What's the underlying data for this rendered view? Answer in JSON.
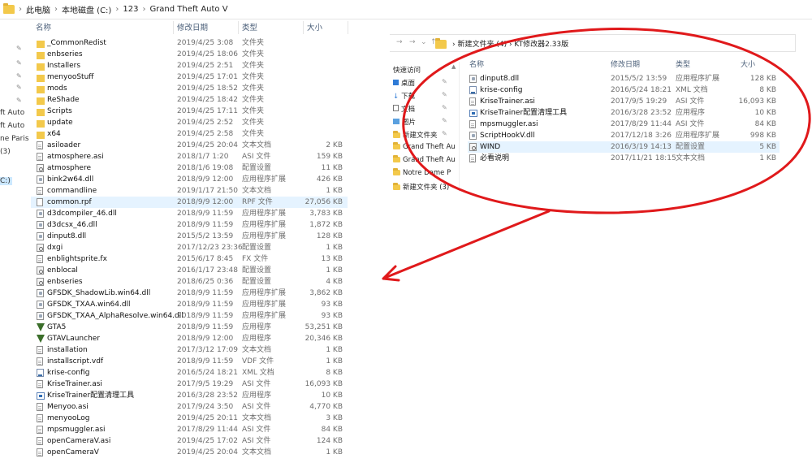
{
  "breadcrumb": [
    "此电脑",
    "本地磁盘 (C:)",
    "123",
    "Grand Theft Auto V"
  ],
  "tree": {
    "items": [
      "ft Auto",
      "ft Auto",
      "ne Paris",
      "(3)",
      "C:)"
    ]
  },
  "columns": {
    "name": "名称",
    "date": "修改日期",
    "type": "类型",
    "size": "大小"
  },
  "files": [
    {
      "name": "_CommonRedist",
      "date": "2019/4/25 3:08",
      "type": "文件夹",
      "size": "",
      "icon": "folder"
    },
    {
      "name": "enbseries",
      "date": "2019/4/25 18:06",
      "type": "文件夹",
      "size": "",
      "icon": "folder"
    },
    {
      "name": "Installers",
      "date": "2019/4/25 2:51",
      "type": "文件夹",
      "size": "",
      "icon": "folder"
    },
    {
      "name": "menyooStuff",
      "date": "2019/4/25 17:01",
      "type": "文件夹",
      "size": "",
      "icon": "folder"
    },
    {
      "name": "mods",
      "date": "2019/4/25 18:52",
      "type": "文件夹",
      "size": "",
      "icon": "folder"
    },
    {
      "name": "ReShade",
      "date": "2019/4/25 18:42",
      "type": "文件夹",
      "size": "",
      "icon": "folder"
    },
    {
      "name": "Scripts",
      "date": "2019/4/25 17:11",
      "type": "文件夹",
      "size": "",
      "icon": "folder"
    },
    {
      "name": "update",
      "date": "2019/4/25 2:52",
      "type": "文件夹",
      "size": "",
      "icon": "folder"
    },
    {
      "name": "x64",
      "date": "2019/4/25 2:58",
      "type": "文件夹",
      "size": "",
      "icon": "folder"
    },
    {
      "name": "asiloader",
      "date": "2019/4/25 20:04",
      "type": "文本文档",
      "size": "2 KB",
      "icon": "file"
    },
    {
      "name": "atmosphere.asi",
      "date": "2018/1/7 1:20",
      "type": "ASI 文件",
      "size": "159 KB",
      "icon": "file"
    },
    {
      "name": "atmosphere",
      "date": "2018/1/6 19:08",
      "type": "配置设置",
      "size": "11 KB",
      "icon": "cfg"
    },
    {
      "name": "bink2w64.dll",
      "date": "2018/9/9 12:00",
      "type": "应用程序扩展",
      "size": "426 KB",
      "icon": "dll"
    },
    {
      "name": "commandline",
      "date": "2019/1/17 21:50",
      "type": "文本文档",
      "size": "1 KB",
      "icon": "file"
    },
    {
      "name": "common.rpf",
      "date": "2018/9/9 12:00",
      "type": "RPF 文件",
      "size": "27,056 KB",
      "icon": "rpf"
    },
    {
      "name": "d3dcompiler_46.dll",
      "date": "2018/9/9 11:59",
      "type": "应用程序扩展",
      "size": "3,783 KB",
      "icon": "dll"
    },
    {
      "name": "d3dcsx_46.dll",
      "date": "2018/9/9 11:59",
      "type": "应用程序扩展",
      "size": "1,872 KB",
      "icon": "dll"
    },
    {
      "name": "dinput8.dll",
      "date": "2015/5/2 13:59",
      "type": "应用程序扩展",
      "size": "128 KB",
      "icon": "dll"
    },
    {
      "name": "dxgi",
      "date": "2017/12/23 23:36",
      "type": "配置设置",
      "size": "1 KB",
      "icon": "cfg"
    },
    {
      "name": "enblightsprite.fx",
      "date": "2015/6/17 8:45",
      "type": "FX 文件",
      "size": "13 KB",
      "icon": "file"
    },
    {
      "name": "enblocal",
      "date": "2016/1/17 23:48",
      "type": "配置设置",
      "size": "1 KB",
      "icon": "cfg"
    },
    {
      "name": "enbseries",
      "date": "2018/6/25 0:36",
      "type": "配置设置",
      "size": "4 KB",
      "icon": "cfg"
    },
    {
      "name": "GFSDK_ShadowLib.win64.dll",
      "date": "2018/9/9 11:59",
      "type": "应用程序扩展",
      "size": "3,862 KB",
      "icon": "dll"
    },
    {
      "name": "GFSDK_TXAA.win64.dll",
      "date": "2018/9/9 11:59",
      "type": "应用程序扩展",
      "size": "93 KB",
      "icon": "dll"
    },
    {
      "name": "GFSDK_TXAA_AlphaResolve.win64.dll",
      "date": "2018/9/9 11:59",
      "type": "应用程序扩展",
      "size": "93 KB",
      "icon": "dll"
    },
    {
      "name": "GTA5",
      "date": "2018/9/9 11:59",
      "type": "应用程序",
      "size": "53,251 KB",
      "icon": "gta"
    },
    {
      "name": "GTAVLauncher",
      "date": "2018/9/9 12:00",
      "type": "应用程序",
      "size": "20,346 KB",
      "icon": "gta"
    },
    {
      "name": "installation",
      "date": "2017/3/12 17:09",
      "type": "文本文档",
      "size": "1 KB",
      "icon": "file"
    },
    {
      "name": "installscript.vdf",
      "date": "2018/9/9 11:59",
      "type": "VDF 文件",
      "size": "1 KB",
      "icon": "file"
    },
    {
      "name": "krise-config",
      "date": "2016/5/24 18:21",
      "type": "XML 文档",
      "size": "8 KB",
      "icon": "xml"
    },
    {
      "name": "KriseTrainer.asi",
      "date": "2017/9/5 19:29",
      "type": "ASI 文件",
      "size": "16,093 KB",
      "icon": "file"
    },
    {
      "name": "KriseTrainer配置清理工具",
      "date": "2016/3/28 23:52",
      "type": "应用程序",
      "size": "10 KB",
      "icon": "app"
    },
    {
      "name": "Menyoo.asi",
      "date": "2017/9/24 3:50",
      "type": "ASI 文件",
      "size": "4,770 KB",
      "icon": "file"
    },
    {
      "name": "menyooLog",
      "date": "2019/4/25 20:11",
      "type": "文本文档",
      "size": "3 KB",
      "icon": "file"
    },
    {
      "name": "mpsmuggler.asi",
      "date": "2017/8/29 11:44",
      "type": "ASI 文件",
      "size": "84 KB",
      "icon": "file"
    },
    {
      "name": "openCameraV.asi",
      "date": "2019/4/25 17:02",
      "type": "ASI 文件",
      "size": "124 KB",
      "icon": "file"
    },
    {
      "name": "openCameraV",
      "date": "2019/4/25 20:04",
      "type": "文本文档",
      "size": "1 KB",
      "icon": "file"
    }
  ],
  "window2": {
    "path": [
      "新建文件夹 (4)",
      "KT修改器2.33版"
    ],
    "sidebar": [
      "快速访问",
      "桌面",
      "下载",
      "文档",
      "图片",
      "新建文件夹",
      "Grand Theft Au",
      "Grand Theft Au",
      "Notre Dame P",
      "新建文件夹 (3)"
    ],
    "columns": {
      "name": "名称",
      "date": "修改日期",
      "type": "类型",
      "size": "大小"
    },
    "files": [
      {
        "name": "dinput8.dll",
        "date": "2015/5/2 13:59",
        "type": "应用程序扩展",
        "size": "128 KB",
        "icon": "dll"
      },
      {
        "name": "krise-config",
        "date": "2016/5/24 18:21",
        "type": "XML 文档",
        "size": "8 KB",
        "icon": "xml"
      },
      {
        "name": "KriseTrainer.asi",
        "date": "2017/9/5 19:29",
        "type": "ASI 文件",
        "size": "16,093 KB",
        "icon": "file"
      },
      {
        "name": "KriseTrainer配置清理工具",
        "date": "2016/3/28 23:52",
        "type": "应用程序",
        "size": "10 KB",
        "icon": "app"
      },
      {
        "name": "mpsmuggler.asi",
        "date": "2017/8/29 11:44",
        "type": "ASI 文件",
        "size": "84 KB",
        "icon": "file"
      },
      {
        "name": "ScriptHookV.dll",
        "date": "2017/12/18 3:26",
        "type": "应用程序扩展",
        "size": "998 KB",
        "icon": "dll"
      },
      {
        "name": "WIND",
        "date": "2016/3/19 14:13",
        "type": "配置设置",
        "size": "5 KB",
        "icon": "cfg"
      },
      {
        "name": "必看说明",
        "date": "2017/11/21 18:15",
        "type": "文本文档",
        "size": "1 KB",
        "icon": "file"
      }
    ]
  },
  "annotation": {
    "color": "#e0191b"
  }
}
